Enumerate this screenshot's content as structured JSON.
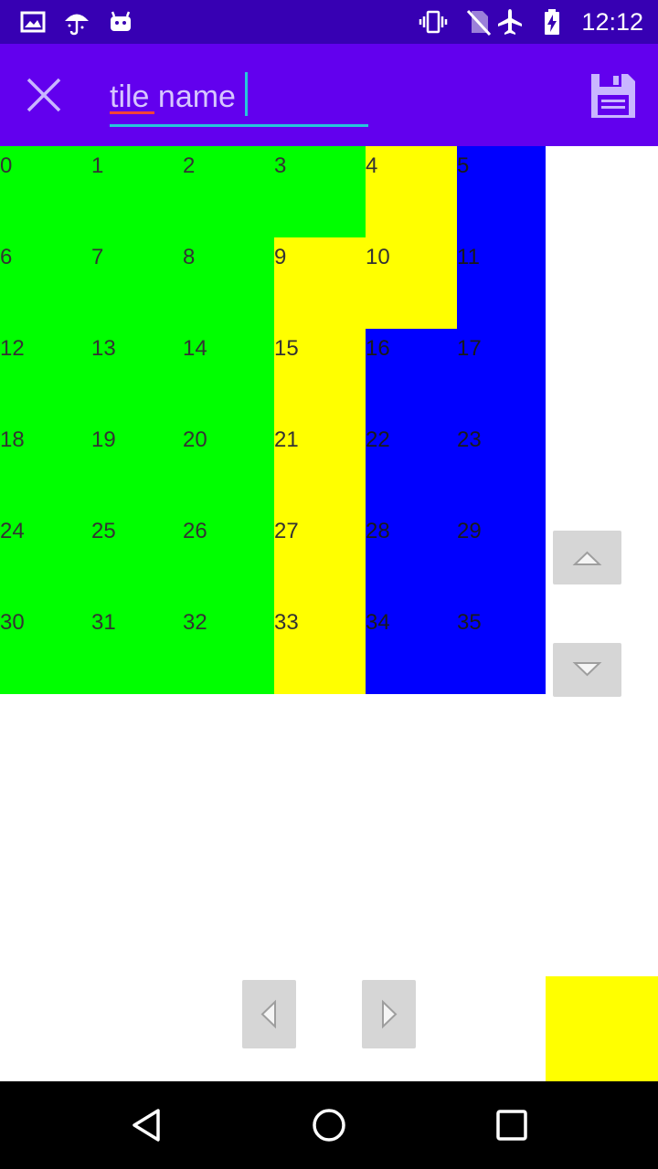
{
  "status_bar": {
    "time": "12:12",
    "left_icons": [
      "image-icon",
      "umbrella-icon",
      "android-icon"
    ],
    "right_icons": [
      "vibrate-icon",
      "no-sim-icon",
      "airplane-icon",
      "battery-charging-icon"
    ]
  },
  "toolbar": {
    "close_icon": "close-icon",
    "name_value": "tile name",
    "save_icon": "save-icon"
  },
  "colors": {
    "status_bar": "#3700b3",
    "app_bar": "#6200ee",
    "accent": "#26c6da",
    "green": "#00ff00",
    "yellow": "#ffff00",
    "blue": "#0000ff"
  },
  "grid": {
    "cells": [
      {
        "label": "0",
        "color": "#00ff00"
      },
      {
        "label": "1",
        "color": "#00ff00"
      },
      {
        "label": "2",
        "color": "#00ff00"
      },
      {
        "label": "3",
        "color": "#00ff00"
      },
      {
        "label": "4",
        "color": "#ffff00"
      },
      {
        "label": "5",
        "color": "#0000ff"
      },
      {
        "label": "6",
        "color": "#00ff00"
      },
      {
        "label": "7",
        "color": "#00ff00"
      },
      {
        "label": "8",
        "color": "#00ff00"
      },
      {
        "label": "9",
        "color": "#ffff00"
      },
      {
        "label": "10",
        "color": "#ffff00"
      },
      {
        "label": "11",
        "color": "#0000ff"
      },
      {
        "label": "12",
        "color": "#00ff00"
      },
      {
        "label": "13",
        "color": "#00ff00"
      },
      {
        "label": "14",
        "color": "#00ff00"
      },
      {
        "label": "15",
        "color": "#ffff00"
      },
      {
        "label": "16",
        "color": "#0000ff"
      },
      {
        "label": "17",
        "color": "#0000ff"
      },
      {
        "label": "18",
        "color": "#00ff00"
      },
      {
        "label": "19",
        "color": "#00ff00"
      },
      {
        "label": "20",
        "color": "#00ff00"
      },
      {
        "label": "21",
        "color": "#ffff00"
      },
      {
        "label": "22",
        "color": "#0000ff"
      },
      {
        "label": "23",
        "color": "#0000ff"
      },
      {
        "label": "24",
        "color": "#00ff00"
      },
      {
        "label": "25",
        "color": "#00ff00"
      },
      {
        "label": "26",
        "color": "#00ff00"
      },
      {
        "label": "27",
        "color": "#ffff00"
      },
      {
        "label": "28",
        "color": "#0000ff"
      },
      {
        "label": "29",
        "color": "#0000ff"
      },
      {
        "label": "30",
        "color": "#00ff00"
      },
      {
        "label": "31",
        "color": "#00ff00"
      },
      {
        "label": "32",
        "color": "#00ff00"
      },
      {
        "label": "33",
        "color": "#ffff00"
      },
      {
        "label": "34",
        "color": "#0000ff"
      },
      {
        "label": "35",
        "color": "#0000ff"
      }
    ]
  },
  "controls": {
    "up_icon": "arrow-up-icon",
    "down_icon": "arrow-down-icon",
    "prev_icon": "arrow-left-icon",
    "next_icon": "arrow-right-icon",
    "current_color": "#ffff00"
  },
  "nav_bar": {
    "icons": [
      "back-icon",
      "home-icon",
      "recents-icon"
    ]
  }
}
